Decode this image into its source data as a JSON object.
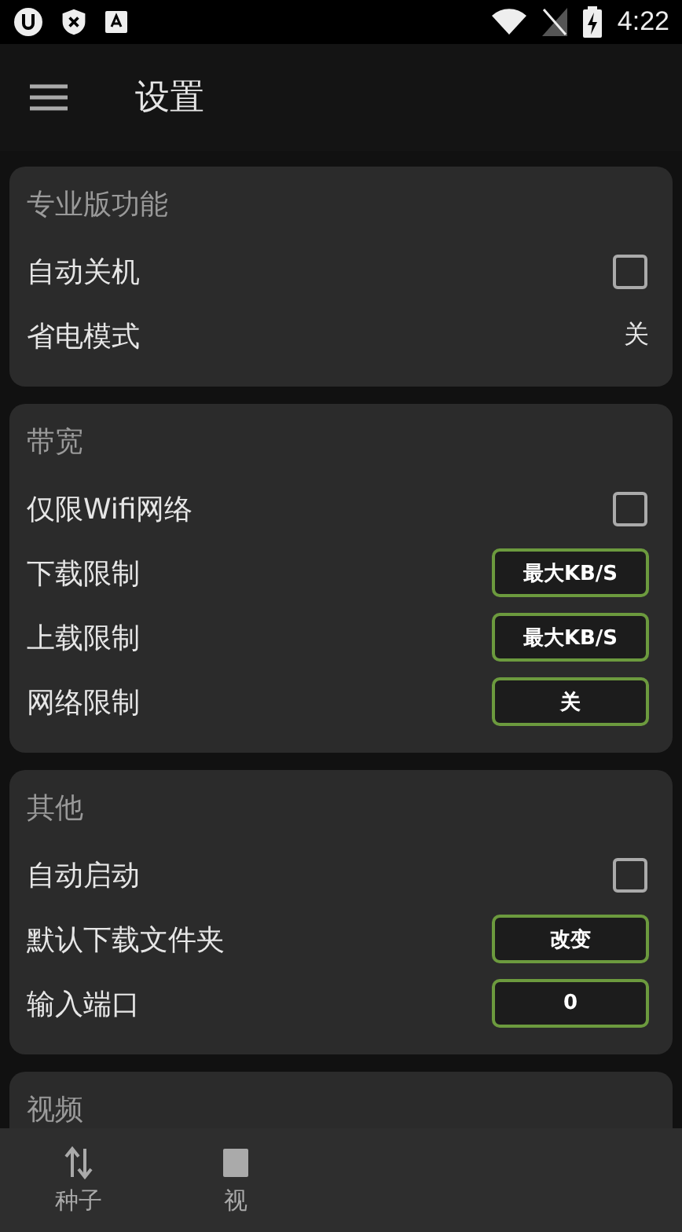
{
  "status_bar": {
    "time": "4:22"
  },
  "app_bar": {
    "title": "设置"
  },
  "sections": [
    {
      "title": "专业版功能",
      "rows": [
        {
          "kind": "checkbox",
          "label": "自动关机",
          "checked": false
        },
        {
          "kind": "value",
          "label": "省电模式",
          "value": "关"
        }
      ]
    },
    {
      "title": "带宽",
      "rows": [
        {
          "kind": "checkbox",
          "label": "仅限Wifi网络",
          "checked": false
        },
        {
          "kind": "button",
          "label": "下载限制",
          "value": "最大KB/S"
        },
        {
          "kind": "button",
          "label": "上载限制",
          "value": "最大KB/S"
        },
        {
          "kind": "button",
          "label": "网络限制",
          "value": "关"
        }
      ]
    },
    {
      "title": "其他",
      "rows": [
        {
          "kind": "checkbox",
          "label": "自动启动",
          "checked": false
        },
        {
          "kind": "button",
          "label": "默认下载文件夹",
          "value": "改变"
        },
        {
          "kind": "button",
          "label": "输入端口",
          "value": "0"
        }
      ]
    },
    {
      "title": "视频"
    }
  ],
  "bottom_nav": [
    {
      "label": "种子"
    },
    {
      "label": "视"
    }
  ]
}
